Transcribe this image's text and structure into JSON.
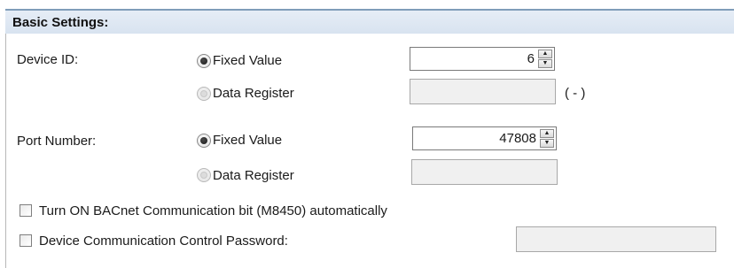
{
  "header": {
    "title": "Basic Settings:"
  },
  "device_id": {
    "label": "Device ID:",
    "fixed_label": "Fixed Value",
    "register_label": "Data Register",
    "value": "6",
    "register_suffix": "( - )"
  },
  "port": {
    "label": "Port Number:",
    "fixed_label": "Fixed Value",
    "register_label": "Data Register",
    "value": "47808"
  },
  "checkboxes": {
    "auto_on": "Turn ON BACnet Communication bit (M8450) automatically",
    "password": "Device Communication Control Password:"
  },
  "spinner": {
    "up_glyph": "▲",
    "down_glyph": "▼"
  }
}
